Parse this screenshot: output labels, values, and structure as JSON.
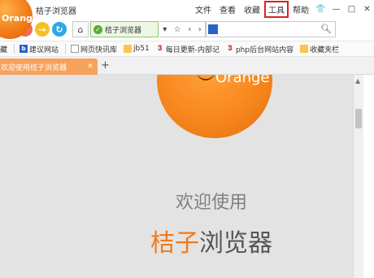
{
  "app": {
    "title": "桔子浏览器",
    "logo_text": "Orange",
    "accent_color": "#f07a1a"
  },
  "menu": {
    "items": [
      "文件",
      "查看",
      "收藏",
      "工具",
      "帮助"
    ],
    "active_item": "工具",
    "window_buttons": [
      "skin-icon",
      "minimize",
      "maximize",
      "close"
    ]
  },
  "nav": {
    "back": "←",
    "forward": "→",
    "refresh": "↻",
    "secure_site_label": "桔子浏览器",
    "search_placeholder": ""
  },
  "bookmarks": [
    {
      "label": "藏",
      "icon": "folder"
    },
    {
      "label": "建议网站",
      "icon": "baidu"
    },
    {
      "label": "网页快讯库",
      "icon": "doc"
    },
    {
      "label": "jb51",
      "icon": "folder"
    },
    {
      "label": "每日更新-内部记",
      "icon": "3"
    },
    {
      "label": "php后台网站内容",
      "icon": "3"
    },
    {
      "label": "收藏夹栏",
      "icon": "folder"
    }
  ],
  "tabs": [
    {
      "title": "欢迎使用桔子浏览器",
      "active": true
    }
  ],
  "content": {
    "ball_text": "Orange",
    "welcome_text": "欢迎使用",
    "product_accent": "桔子",
    "product_rest": "浏览器"
  }
}
